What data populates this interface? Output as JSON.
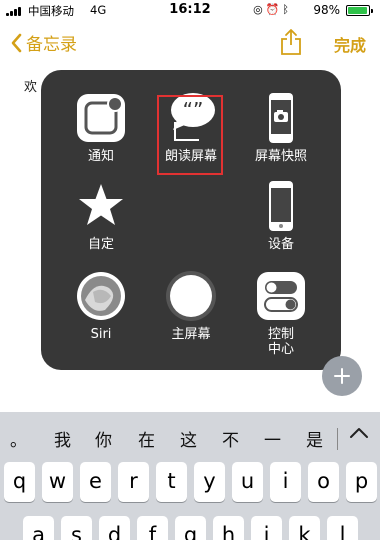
{
  "status_bar": {
    "carrier": "中国移动",
    "network": "4G",
    "time": "16:12",
    "battery_percent": "98%",
    "battery_level": 0.98,
    "battery_color": "#2fc24a",
    "icons": [
      "rotation-lock-icon",
      "alarm-icon",
      "bluetooth-icon"
    ]
  },
  "nav": {
    "back_label": "备忘录",
    "done_label": "完成",
    "accent_color": "#d4a017"
  },
  "note": {
    "text": "欢"
  },
  "assistive_menu": {
    "items": [
      {
        "label": "通知",
        "icon": "notification-icon"
      },
      {
        "label": "朗读屏幕",
        "icon": "speak-screen-icon",
        "highlighted": true
      },
      {
        "label": "屏幕快照",
        "icon": "screenshot-icon"
      },
      {
        "label": "自定",
        "icon": "star-icon"
      },
      {
        "label": "设备",
        "icon": "device-icon"
      },
      {
        "label": "Siri",
        "icon": "siri-icon"
      },
      {
        "label": "主屏幕",
        "icon": "home-icon"
      },
      {
        "label": "控制\n中心",
        "icon": "control-center-icon"
      }
    ],
    "highlight_color": "#e23232"
  },
  "keyboard": {
    "candidates": [
      "。",
      "我",
      "你",
      "在",
      "这",
      "不",
      "一",
      "是"
    ],
    "row1": [
      "q",
      "w",
      "e",
      "r",
      "t",
      "y",
      "u",
      "i",
      "o",
      "p"
    ],
    "row2": [
      "a",
      "s",
      "d",
      "f",
      "g",
      "h",
      "j",
      "k",
      "l"
    ]
  }
}
